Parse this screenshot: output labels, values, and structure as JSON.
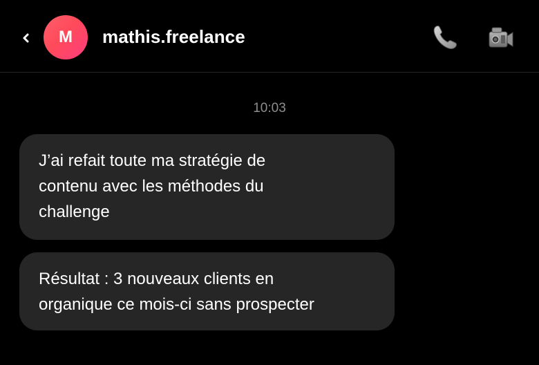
{
  "header": {
    "avatar_initial": "M",
    "username": "mathis.freelance",
    "back_icon": "chevron-left-icon",
    "call_icon": "phone-icon",
    "video_icon": "video-camera-icon"
  },
  "conversation": {
    "timestamp": "10:03",
    "messages": [
      {
        "lines": [
          "J’ai refait toute ma stratégie de",
          "contenu avec les méthodes du",
          "challenge"
        ]
      },
      {
        "lines": [
          "Résultat : 3 nouveaux clients en",
          "organique ce mois-ci sans prospecter"
        ]
      }
    ]
  },
  "colors": {
    "background": "#000000",
    "bubble": "#262626",
    "timestamp": "#8e8e8e",
    "avatar_gradient_start": "#ff5f6d",
    "avatar_gradient_end": "#ff3d7f"
  }
}
